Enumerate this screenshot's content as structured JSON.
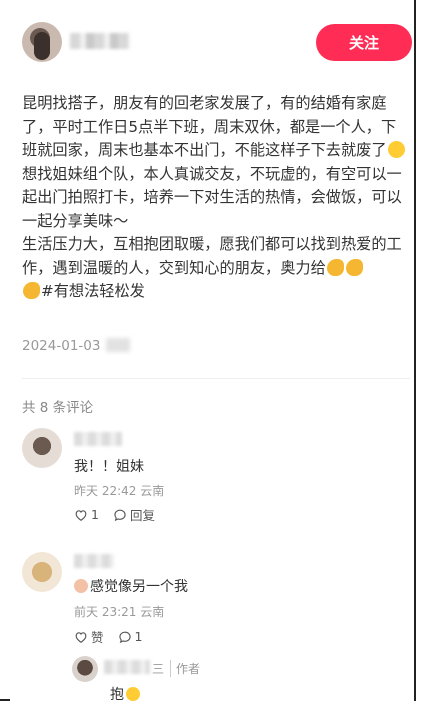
{
  "header": {
    "follow_label": "关注"
  },
  "post": {
    "para1": "昆明找搭子，朋友有的回老家发展了，有的结婚有家庭了，平时工作日5点半下班，周末双休，都是一个人，下班就回家，周末也基本不出门，不能这样子下去就废了",
    "para2": "想找姐妹组个队，本人真诚交友，不玩虚的，有空可以一起出门拍照打卡，培养一下对生活的热情，会做饭，可以一起分享美味～",
    "para3": "生活压力大，互相抱团取暖，愿我们都可以找到热爱的工作，遇到温暖的人，交到知心的朋友，奥力给",
    "hashtag": "#有想法轻松发",
    "date": "2024-01-03"
  },
  "comments_header": "共 8 条评论",
  "comments": [
    {
      "text": "我！！姐妹",
      "meta": "昨天 22:42 云南",
      "likes": "1",
      "reply_label": "回复"
    },
    {
      "text": "感觉像另一个我",
      "meta": "前天 23:21 云南",
      "like_label": "赞",
      "replies": "1"
    },
    {
      "text": "抱",
      "author_tag": "作者",
      "name_suffix": "三"
    }
  ]
}
